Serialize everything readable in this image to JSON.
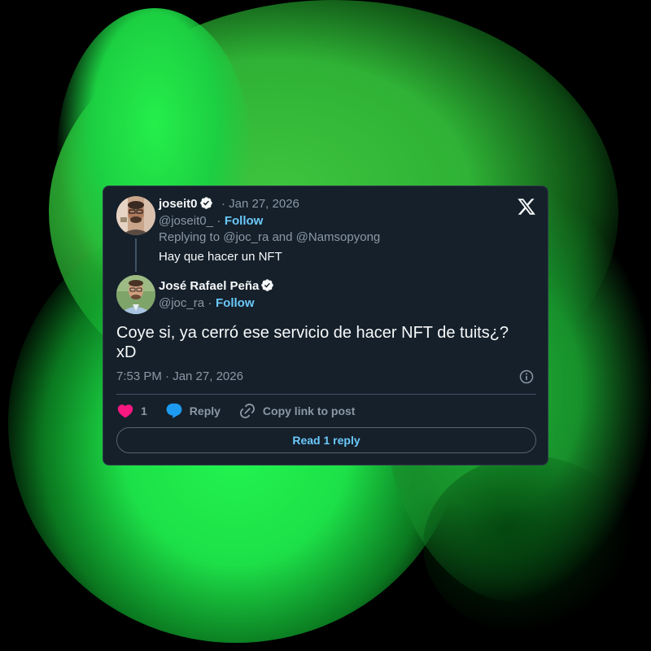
{
  "tweet_parent": {
    "author_name": "joseit0",
    "date_prefix": "· Jan 27, 2026",
    "handle": "@joseit0_",
    "separator": "·",
    "follow_label": "Follow",
    "replying_to": "Replying to @joc_ra and @Namsopyong",
    "text": "Hay que hacer un NFT"
  },
  "tweet_main": {
    "author_name": "José Rafael Peña",
    "handle": "@joc_ra",
    "separator": "·",
    "follow_label": "Follow",
    "text": "Coye si, ya cerró ese servicio de hacer NFT de tuits¿? xD",
    "timestamp": "7:53 PM · Jan 27, 2026"
  },
  "actions": {
    "like_count": "1",
    "reply_label": "Reply",
    "copy_link_label": "Copy link to post"
  },
  "read_reply_label": "Read 1 reply",
  "icons": {
    "brand": "x-logo-icon",
    "verified": "verified-badge-icon",
    "like": "heart-icon",
    "reply": "reply-bubble-icon",
    "copy": "link-icon",
    "info": "info-icon"
  },
  "colors": {
    "card_bg": "#15202b",
    "accent": "#6bc9fb",
    "like": "#f91880",
    "reply": "#1d9bf0",
    "muted": "#8b98a5"
  }
}
